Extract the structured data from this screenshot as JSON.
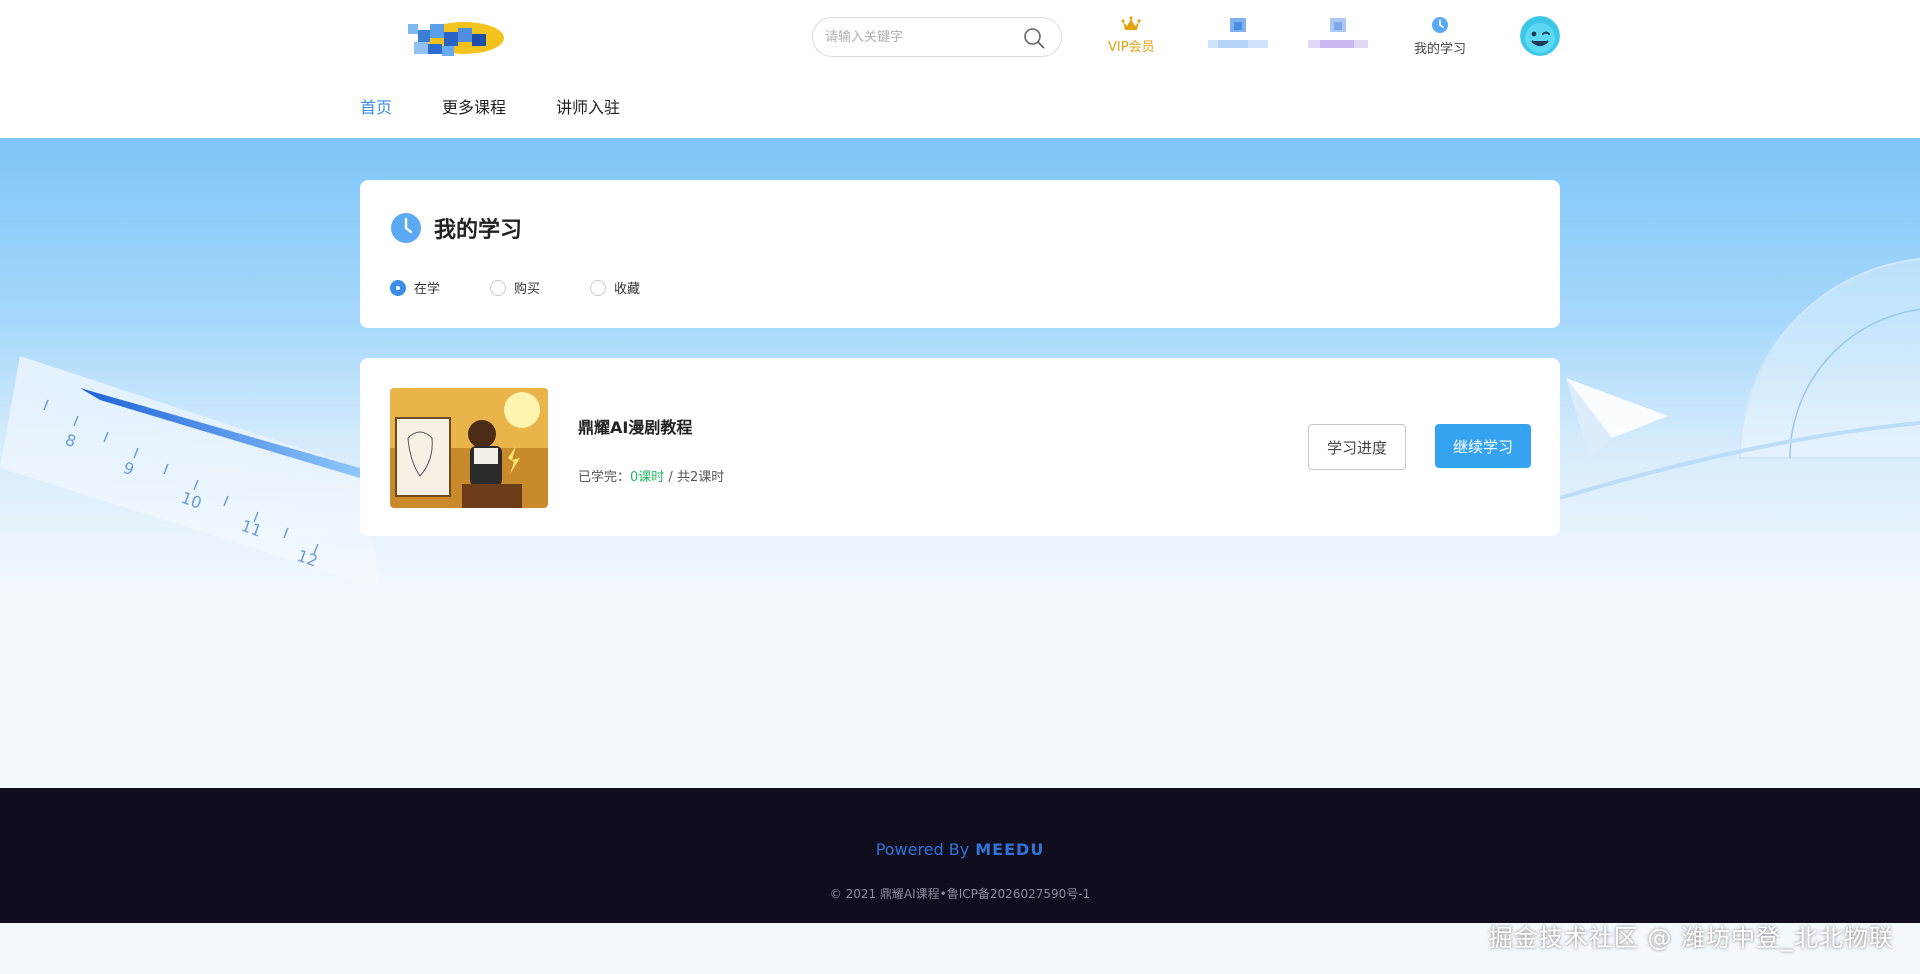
{
  "header": {
    "search_placeholder": "请输入关键字",
    "vip_label": "VIP会员",
    "my_study_label": "我的学习"
  },
  "nav": {
    "items": [
      "首页",
      "更多课程",
      "讲师入驻"
    ],
    "active_index": 0
  },
  "study": {
    "title": "我的学习",
    "filters": [
      {
        "label": "在学",
        "checked": true
      },
      {
        "label": "购买",
        "checked": false
      },
      {
        "label": "收藏",
        "checked": false
      }
    ]
  },
  "courses": [
    {
      "title": "鼎耀AI漫剧教程",
      "progress_prefix": "已学完：",
      "done": "0课时",
      "separator": " / ",
      "total": "共2课时",
      "progress_button": "学习进度",
      "continue_button": "继续学习"
    }
  ],
  "footer": {
    "powered_by": "Powered By",
    "brand": "MEEDU",
    "copyright": "© 2021 鼎耀AI课程•鲁ICP备2026027590号-1"
  },
  "watermark": "掘金技术社区 @ 潍坊中登_北北物联",
  "colors": {
    "accent": "#3a8ee6",
    "primary_button": "#36a3f0",
    "vip": "#e5a312",
    "footer_bg": "#100d1f",
    "done_green": "#25b864"
  }
}
